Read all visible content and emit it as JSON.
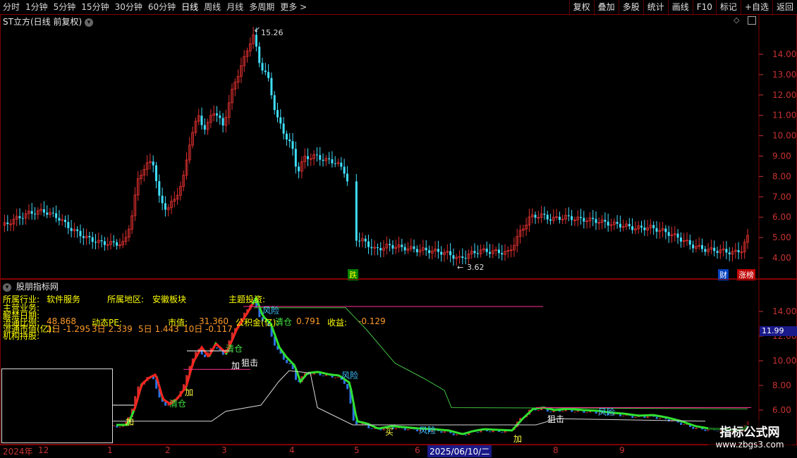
{
  "toolbar": {
    "periods": [
      "分时",
      "1分钟",
      "5分钟",
      "15分钟",
      "30分钟",
      "60分钟",
      "日线",
      "周线",
      "月线",
      "多周期",
      "更多 >"
    ],
    "active_period": "日线",
    "buttons": [
      "复权",
      "叠加",
      "多股",
      "统计",
      "画线",
      "F10",
      "标记",
      "+自选",
      "返回"
    ]
  },
  "main_chart": {
    "title": "ST立方(日线 前复权)",
    "high_label": "15.26",
    "low_label": "3.62",
    "price_ticks": [
      "14.00",
      "13.00",
      "12.00",
      "11.00",
      "10.00",
      "9.00",
      "8.00",
      "7.00",
      "6.00",
      "5.00",
      "4.00"
    ],
    "badge_left": "跌",
    "badge_right_1": "财",
    "badge_right_2": "涨榜"
  },
  "indicator": {
    "title": "股朋指标网",
    "industry_label": "所属行业:",
    "industry_value": "软件服务",
    "region_label": "所属地区:",
    "region_value": "安徽板块",
    "theme_label": "主题投资:",
    "row2_label": "主营业务:",
    "row3_label": "解禁日期:",
    "row4_label": "流通比例:",
    "row4_value": "48.868",
    "pe_label": "动态PE:",
    "mktcap_label": "市值:",
    "mktcap_value": "31.360",
    "fund_label": "公积金(亿):",
    "fund_value": "0.791",
    "profit_label": "收益:",
    "profit_value": "-0.129",
    "row5_label": "流通市值(亿):",
    "d1": "1日 -1.295",
    "d3": "3日 2.339",
    "d5": "5日 1.443",
    "d10": "10日 -0.117",
    "row6_label": "机构持股:",
    "ticks": [
      "14.00",
      "12.00",
      "10.00",
      "8.00",
      "6.00"
    ],
    "current_price": "11.99",
    "annotations": [
      "风险",
      "风险",
      "风险",
      "风险",
      "清仓",
      "清仓",
      "清仓",
      "加",
      "加",
      "狙击",
      "狙击",
      "加",
      "加",
      "买"
    ]
  },
  "xaxis": {
    "labels": [
      "2024年",
      "12",
      "1",
      "2",
      "3",
      "4",
      "5",
      "6",
      "8",
      "9"
    ],
    "selected_date": "2025/06/10/二"
  },
  "watermark": {
    "title": "指标公式网",
    "url": "www.zbgs3.com"
  },
  "colors": {
    "up": "#e03030",
    "down": "#40e0ff",
    "axis": "#c83232",
    "grid": "#800000"
  }
}
